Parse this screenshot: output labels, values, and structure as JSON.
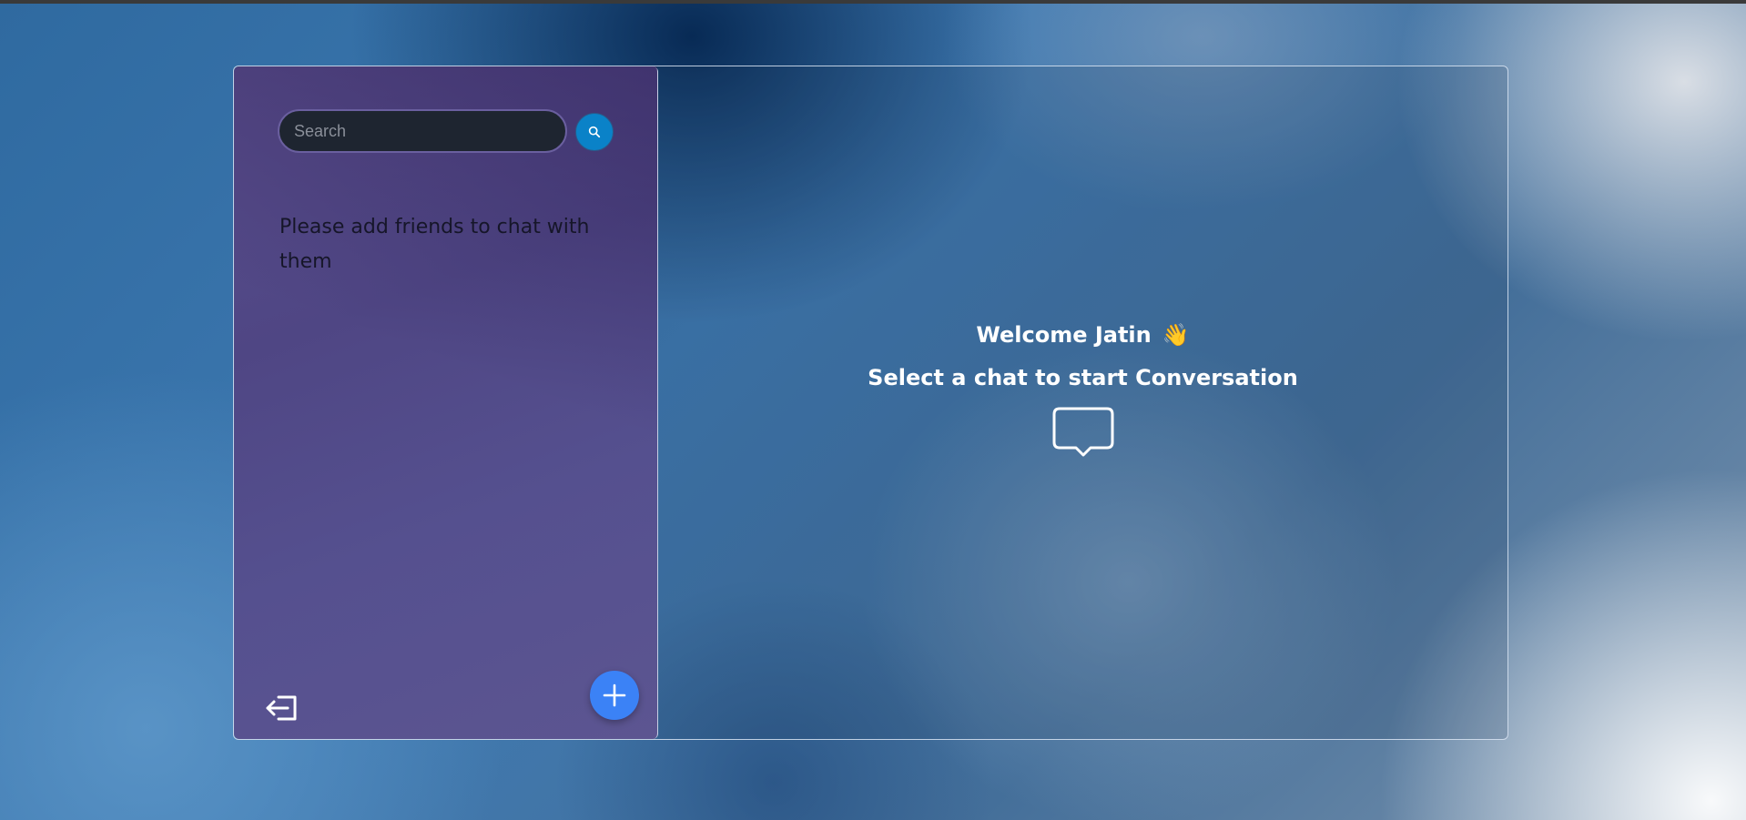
{
  "search": {
    "placeholder": "Search",
    "button_icon": "search-icon"
  },
  "sidebar": {
    "empty_message": "Please add friends to chat with them",
    "logout_icon": "logout-icon",
    "add_icon": "plus-icon"
  },
  "main": {
    "welcome_text": "Welcome Jatin",
    "wave_emoji": "👋",
    "subtitle": "Select a chat to start Conversation",
    "chat_icon": "chat-bubble-icon"
  },
  "colors": {
    "sidebar_bg": "#55508f",
    "search_bg": "#1e2530",
    "search_button": "#0a82c8",
    "add_button": "#3b82f6",
    "text_light": "#ffffff",
    "text_dark": "#161629"
  }
}
